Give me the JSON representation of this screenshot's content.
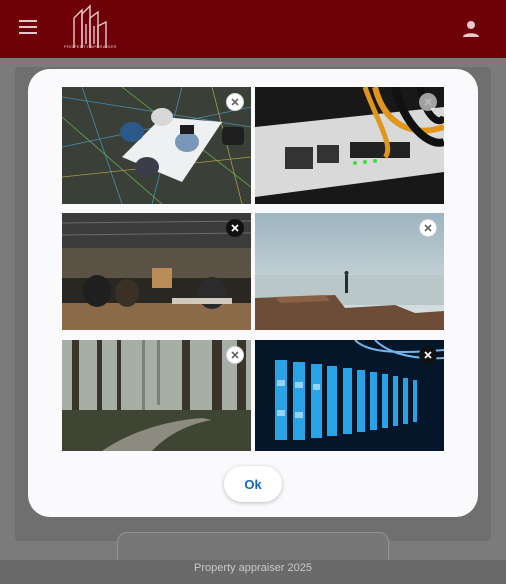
{
  "appbar": {
    "logo_text": "PROPERTY APPRAISER",
    "menu_icon": "menu-icon",
    "account_icon": "person-icon",
    "brand_color": "#6e0007"
  },
  "dialog": {
    "images": [
      {
        "subject": "team-meeting-overhead",
        "remove_icon": "close-icon"
      },
      {
        "subject": "network-router-cables",
        "remove_icon": "close-icon"
      },
      {
        "subject": "cafe-workspace",
        "remove_icon": "close-icon"
      },
      {
        "subject": "sea-landscape",
        "remove_icon": "close-icon"
      },
      {
        "subject": "misty-forest-road",
        "remove_icon": "close-icon"
      },
      {
        "subject": "server-rack-blue",
        "remove_icon": "close-icon"
      }
    ],
    "ok_label": "Ok",
    "ok_color": "#1565c0"
  },
  "footer": {
    "text": "Property appraiser 2025"
  }
}
